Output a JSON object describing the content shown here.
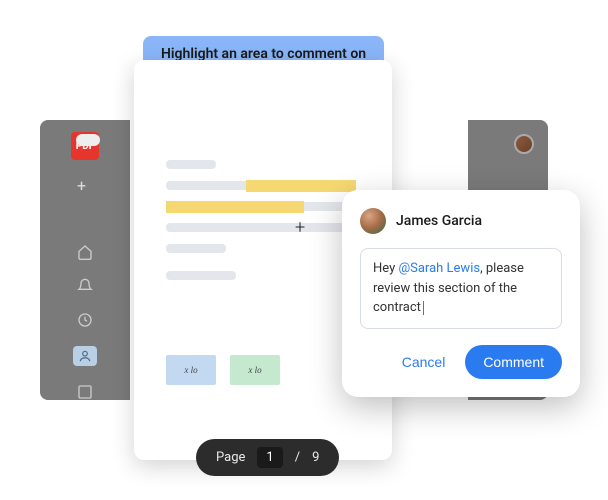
{
  "tooltip": {
    "text": "Highlight an area to comment on"
  },
  "sidebar": {
    "badge": "PDF"
  },
  "signatures": {
    "sig_text": "x lo"
  },
  "pager": {
    "label": "Page",
    "current": "1",
    "sep": "/",
    "total": "9"
  },
  "comment": {
    "author": "James Garcia",
    "text_before": "Hey ",
    "mention": "@Sarah Lewis",
    "text_after": ", please review this section of the contract",
    "cancel_label": "Cancel",
    "submit_label": "Comment"
  }
}
